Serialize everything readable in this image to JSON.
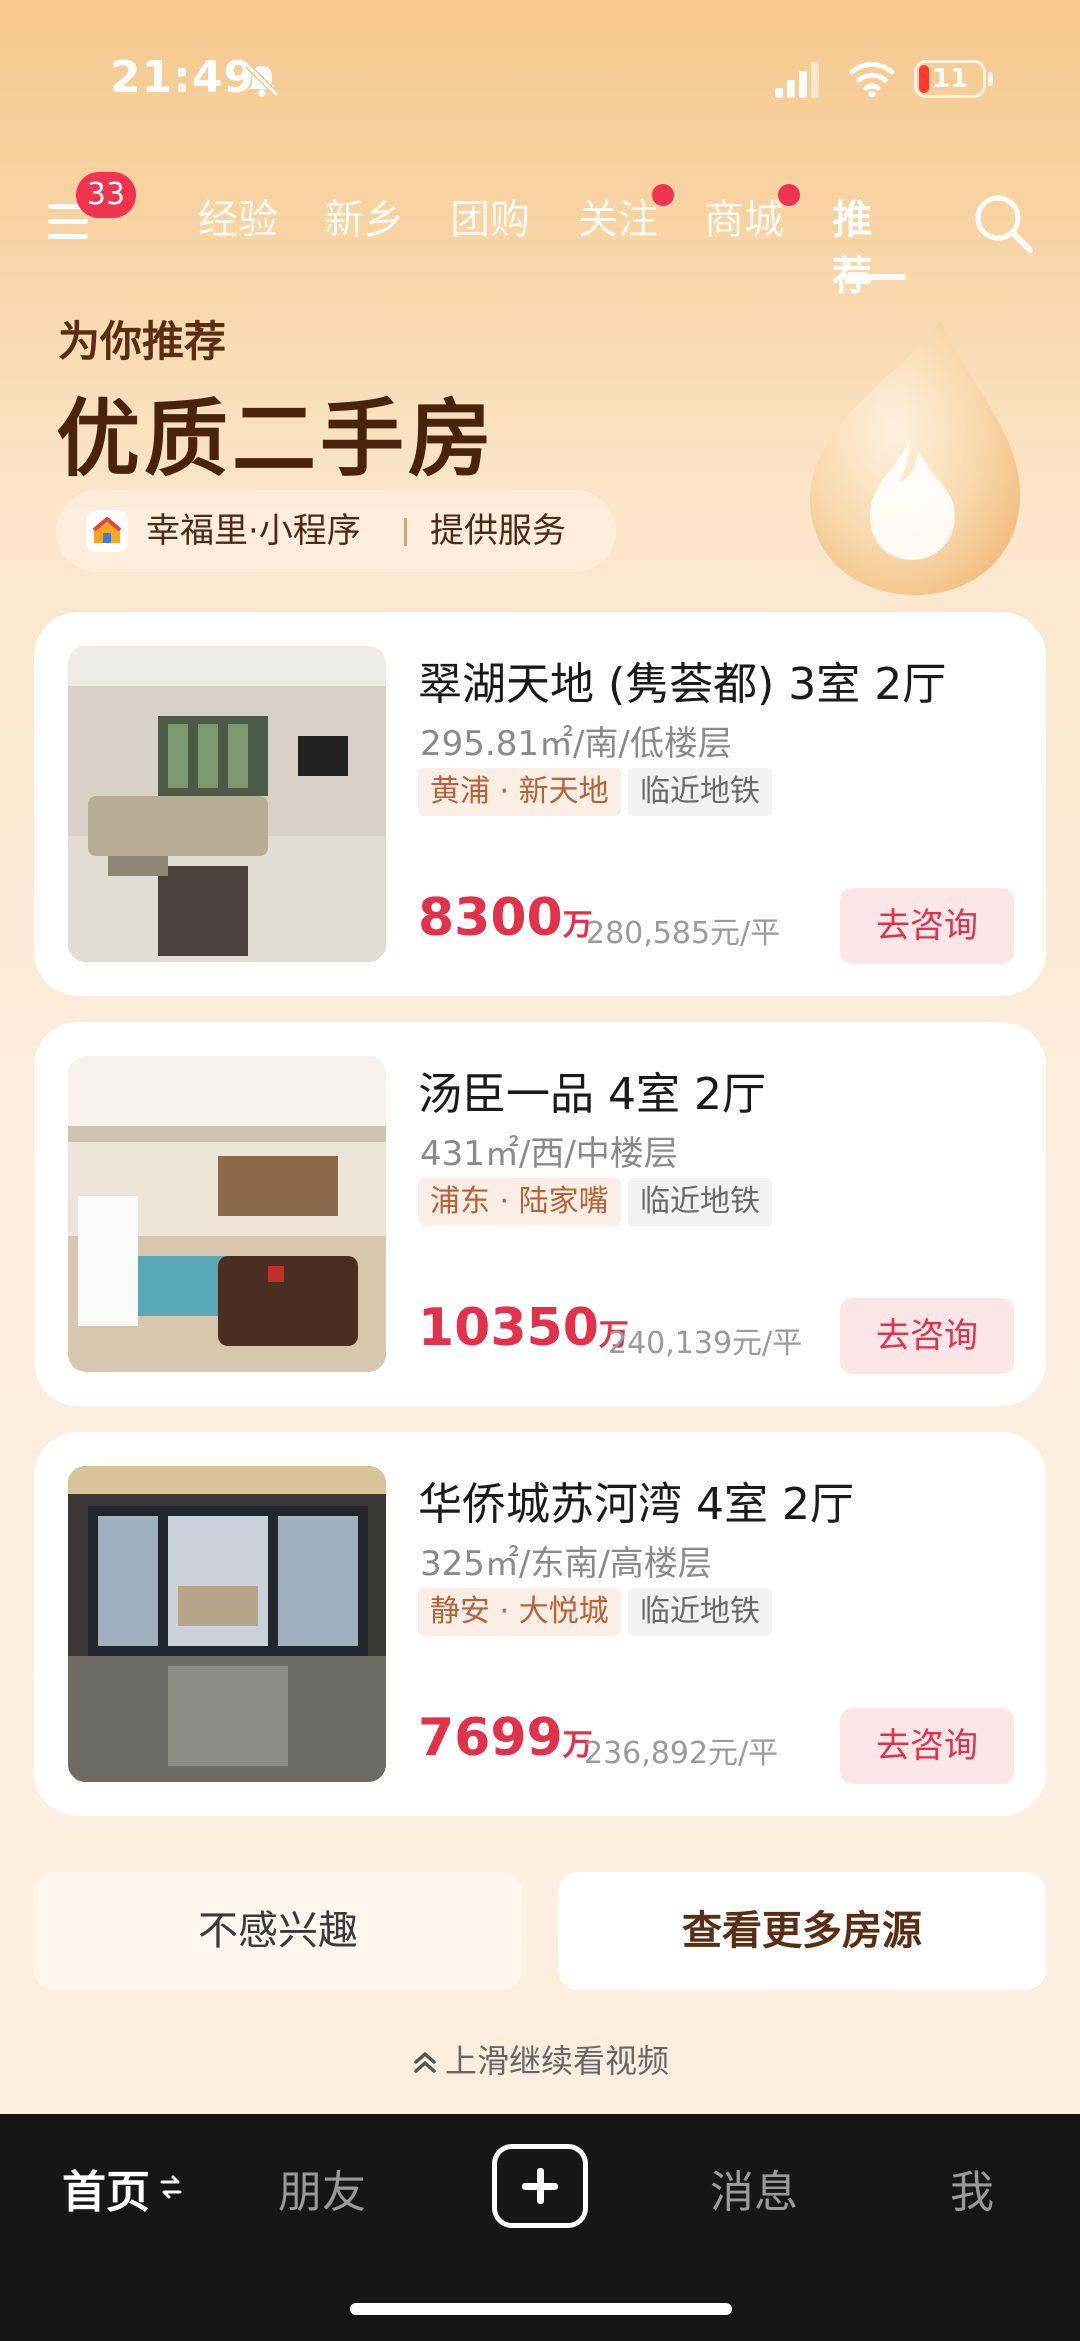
{
  "status_bar": {
    "time": "21:49",
    "battery": "11"
  },
  "top_nav": {
    "menu_badge": "33",
    "tabs": [
      {
        "label": "经验",
        "dot": false,
        "active": false
      },
      {
        "label": "新乡",
        "dot": false,
        "active": false
      },
      {
        "label": "团购",
        "dot": false,
        "active": false
      },
      {
        "label": "关注",
        "dot": true,
        "active": false
      },
      {
        "label": "商城",
        "dot": true,
        "active": false
      },
      {
        "label": "推荐",
        "dot": false,
        "active": true
      }
    ],
    "icons": [
      "menu-icon",
      "search-icon"
    ]
  },
  "hero": {
    "subtitle": "为你推荐",
    "title": "优质二手房",
    "provider_name": "幸福里·小程序",
    "provider_service": "提供服务"
  },
  "listings": [
    {
      "name": "翠湖天地 (隽荟都) 3室 2厅",
      "meta": "295.81㎡/南/低楼层",
      "area_tag": "黄浦 · 新天地",
      "metro_tag": "临近地铁",
      "price": "8300",
      "price_unit": "万",
      "unit_price": "280,585元/平",
      "consult": "去咨询"
    },
    {
      "name": "汤臣一品 4室 2厅",
      "meta": "431㎡/西/中楼层",
      "area_tag": "浦东 · 陆家嘴",
      "metro_tag": "临近地铁",
      "price": "10350",
      "price_unit": "万",
      "unit_price": "240,139元/平",
      "consult": "去咨询"
    },
    {
      "name": "华侨城苏河湾 4室 2厅",
      "meta": "325㎡/东南/高楼层",
      "area_tag": "静安 · 大悦城",
      "metro_tag": "临近地铁",
      "price": "7699",
      "price_unit": "万",
      "unit_price": "236,892元/平",
      "consult": "去咨询"
    }
  ],
  "actions": {
    "not_interested": "不感兴趣",
    "more": "查看更多房源",
    "swipe_hint": "上滑继续看视频"
  },
  "bottom_nav": {
    "home": "首页",
    "friends": "朋友",
    "messages": "消息",
    "me": "我"
  },
  "colors": {
    "accent": "#e2314b",
    "brand_brown": "#4a230b",
    "badge": "#f0334f"
  }
}
